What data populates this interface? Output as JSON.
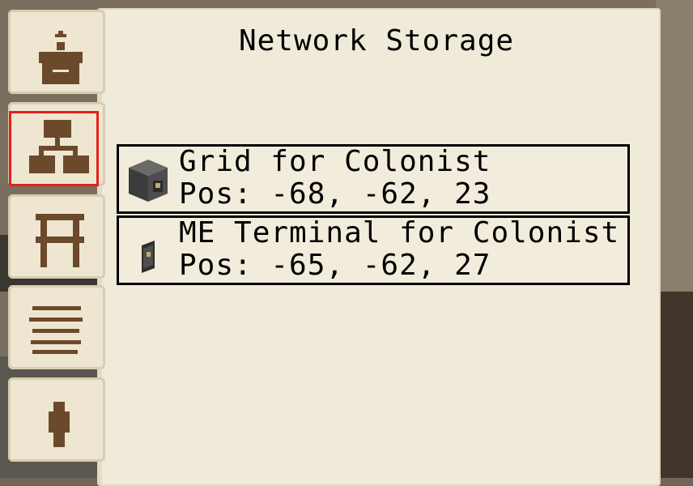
{
  "screen": {
    "title": "Network Storage"
  },
  "tabs": [
    {
      "icon": "building-plus-icon",
      "selected": false
    },
    {
      "icon": "network-hierarchy-icon",
      "selected": true
    },
    {
      "icon": "rack-icon",
      "selected": false
    },
    {
      "icon": "list-lines-icon",
      "selected": false
    },
    {
      "icon": "citizen-icon",
      "selected": false
    }
  ],
  "entries": [
    {
      "name": "Grid for Colonist",
      "pos": "Pos: -68, -62, 23",
      "icon": "grid-block-icon"
    },
    {
      "name": "ME Terminal for Colonist",
      "pos": "Pos: -65, -62, 27",
      "icon": "terminal-panel-icon"
    }
  ],
  "colors": {
    "selection": "#e3201d",
    "parchment": "#f0ead9",
    "icon_brown": "#6b4a2b"
  }
}
